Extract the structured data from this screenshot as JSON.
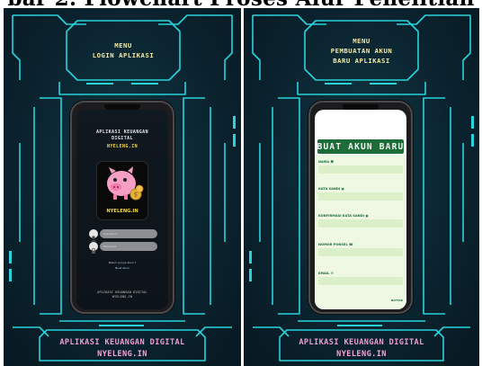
{
  "heading": "bar 2. Flowchart Proses Alur Penelitian",
  "colors": {
    "frame_cyan": "#28d3dc",
    "menu_yellow": "#f4e9a6",
    "brand_yellow": "#f2d84a",
    "footer_pink": "#f09bd0",
    "form_green": "#1d6d38",
    "form_bg": "#eef8e2"
  },
  "left_panel": {
    "menu_lines": [
      "MENU",
      "LOGIN APLIKASI"
    ],
    "app_title_lines": [
      "APLIKASI KEUANGAN",
      "DIGITAL"
    ],
    "app_brand": "NYELENG.IN",
    "logo_brand": "NYELENG.IN",
    "username_placeholder": "Username",
    "password_placeholder": "Password",
    "signup_question": "Belum punya akun ?",
    "signup_link": "Buat Akun",
    "screen_footer_lines": [
      "APLIKASI KEUANGAN DIGITAL",
      "NYELENG.IN"
    ],
    "footer_lines": [
      "APLIKASI KEUANGAN DIGITAL",
      "NYELENG.IN"
    ],
    "icons": [
      "user-icon",
      "lock-icon",
      "piggy-bank-logo"
    ]
  },
  "right_panel": {
    "menu_lines": [
      "MENU",
      "PEMBUATAN AKUN",
      "BARU APLIKASI"
    ],
    "banner": "BUAT AKUN BARU",
    "fields": [
      {
        "label": "NAMA",
        "icon": "user-icon"
      },
      {
        "label": "KATA SANDI",
        "icon": "lock-icon"
      },
      {
        "label": "KONFIRMASI KATA SANDI",
        "icon": "lock-icon"
      },
      {
        "label": "NOMOR PONSEL",
        "icon": "phone-icon"
      },
      {
        "label": "EMAIL",
        "icon": "mail-icon"
      }
    ],
    "submit": "DAFTAR",
    "footer_lines": [
      "APLIKASI KEUANGAN DIGITAL",
      "NYELENG.IN"
    ]
  }
}
